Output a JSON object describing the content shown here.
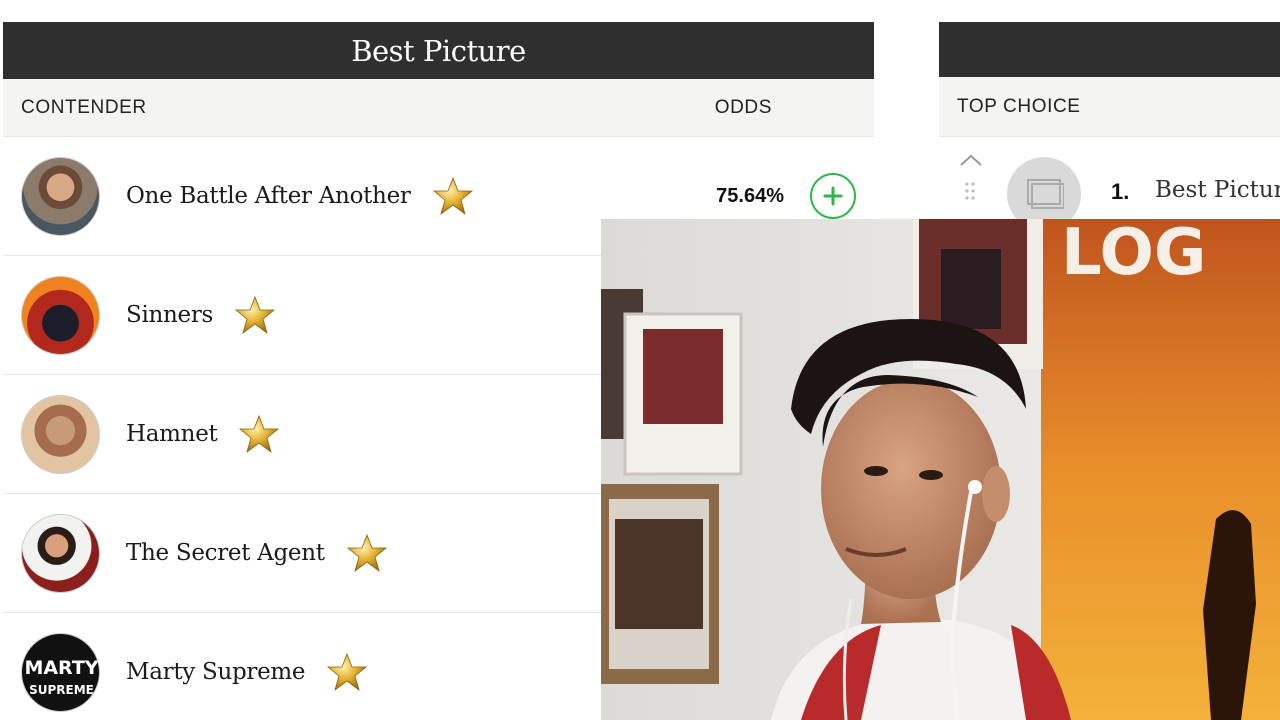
{
  "best_picture": {
    "title": "Best Picture",
    "col_contender": "CONTENDER",
    "col_odds": "ODDS",
    "contenders": [
      {
        "name": "One Battle After Another",
        "odds": "75.64%",
        "avatar_icon": "movie-poster-icon"
      },
      {
        "name": "Sinners",
        "odds": "",
        "avatar_icon": "movie-poster-icon"
      },
      {
        "name": "Hamnet",
        "odds": "",
        "avatar_icon": "movie-poster-icon"
      },
      {
        "name": "The Secret Agent",
        "odds": "",
        "avatar_icon": "movie-poster-icon"
      },
      {
        "name": "Marty Supreme",
        "odds": "",
        "avatar_icon": "movie-poster-icon"
      }
    ],
    "poster_5_text": "MARTY SUPREME"
  },
  "top_choice": {
    "header_title": "",
    "col_label": "TOP CHOICE",
    "items": [
      {
        "rank": "1.",
        "title": "Best Picture"
      }
    ]
  },
  "colors": {
    "header_bg": "#2f2f2f",
    "subheader_bg": "#f4f4f2",
    "add_green": "#2fb64a",
    "star_gold": "#d4a020"
  }
}
